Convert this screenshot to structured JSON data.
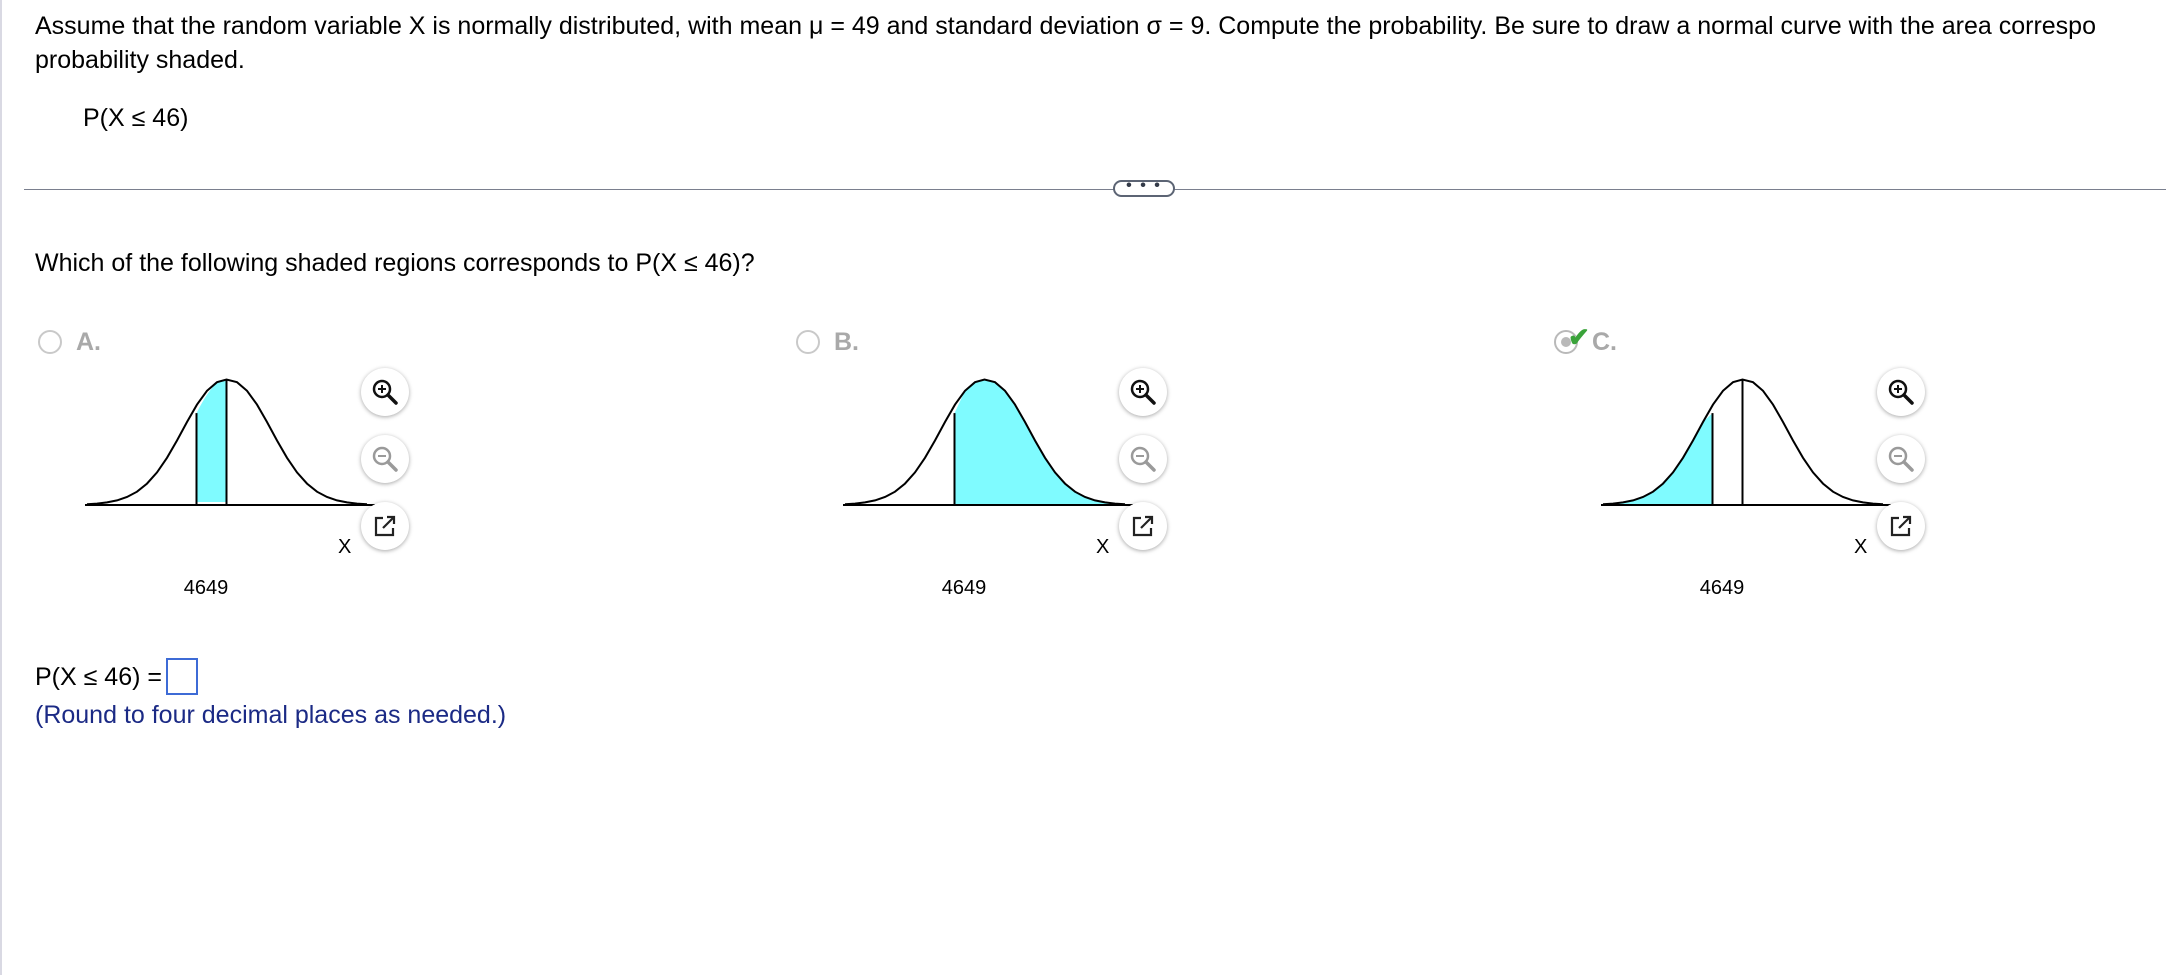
{
  "question": {
    "text": "Assume that the random variable X is normally distributed, with mean μ = 49 and standard deviation σ = 9. Compute the probability. Be sure to draw a normal curve with the area corresponding to the probability shaded.",
    "line1": "Assume that the random variable X is normally distributed, with mean μ = 49 and standard deviation σ = 9. Compute the probability. Be sure to draw a normal curve with the area correspo",
    "line2": "probability shaded.",
    "probability": "P(X ≤ 46)"
  },
  "divider": {
    "expand_label": "• • •"
  },
  "subquestion": {
    "text": "Which of the following shaded regions corresponds to P(X ≤ 46)?"
  },
  "options": [
    {
      "letter": "A.",
      "selected": false,
      "correct": false,
      "tick_label": "4649",
      "axis_label": "X",
      "shading": "between 46 and 49"
    },
    {
      "letter": "B.",
      "selected": false,
      "correct": false,
      "tick_label": "4649",
      "axis_label": "X",
      "shading": "above 46"
    },
    {
      "letter": "C.",
      "selected": true,
      "correct": true,
      "tick_label": "4649",
      "axis_label": "X",
      "shading": "below 46"
    }
  ],
  "tools": {
    "zoom_in": "zoom-in-icon",
    "zoom_out": "zoom-out-icon",
    "popout": "popout-icon"
  },
  "answer": {
    "label": "P(X ≤ 46) =",
    "value": "",
    "hint": "(Round to four decimal places as needed.)"
  },
  "colors": {
    "shade": "#7ffbff",
    "curve": "#000000",
    "correct_check": "#3aa33a",
    "hint_text": "#1b2a85",
    "answer_box_border": "#3d6bd6"
  }
}
